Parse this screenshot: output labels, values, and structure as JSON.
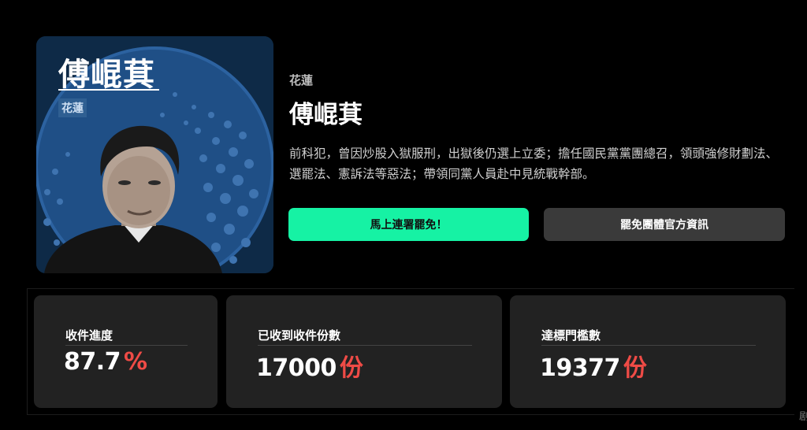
{
  "portrait": {
    "name": "傅崐萁",
    "tag": "花蓮",
    "colors": {
      "background": "#0e2a47",
      "circle": "#1f4f86",
      "dots": "#3f74b0"
    }
  },
  "candidate": {
    "region": "花蓮",
    "name": "傅崐萁",
    "description": "前科犯，曾因炒股入獄服刑，出獄後仍選上立委；擔任國民黨黨團總召，領頭強修財劃法、選罷法、憲訴法等惡法；帶領同黨人員赴中見統戰幹部。"
  },
  "actions": {
    "primary_label": "馬上連署罷免！",
    "secondary_label": "罷免團體官方資訊"
  },
  "stats": [
    {
      "label": "收件進度",
      "value": "87.7",
      "unit": "%"
    },
    {
      "label": "已收到收件份數",
      "value": "17000",
      "unit": "份"
    },
    {
      "label": "達標門檻數",
      "value": "19377",
      "unit": "份"
    }
  ],
  "colors": {
    "accent_green": "#16f2a4",
    "accent_red": "#ef4b46"
  },
  "corner_glyph": "剧"
}
